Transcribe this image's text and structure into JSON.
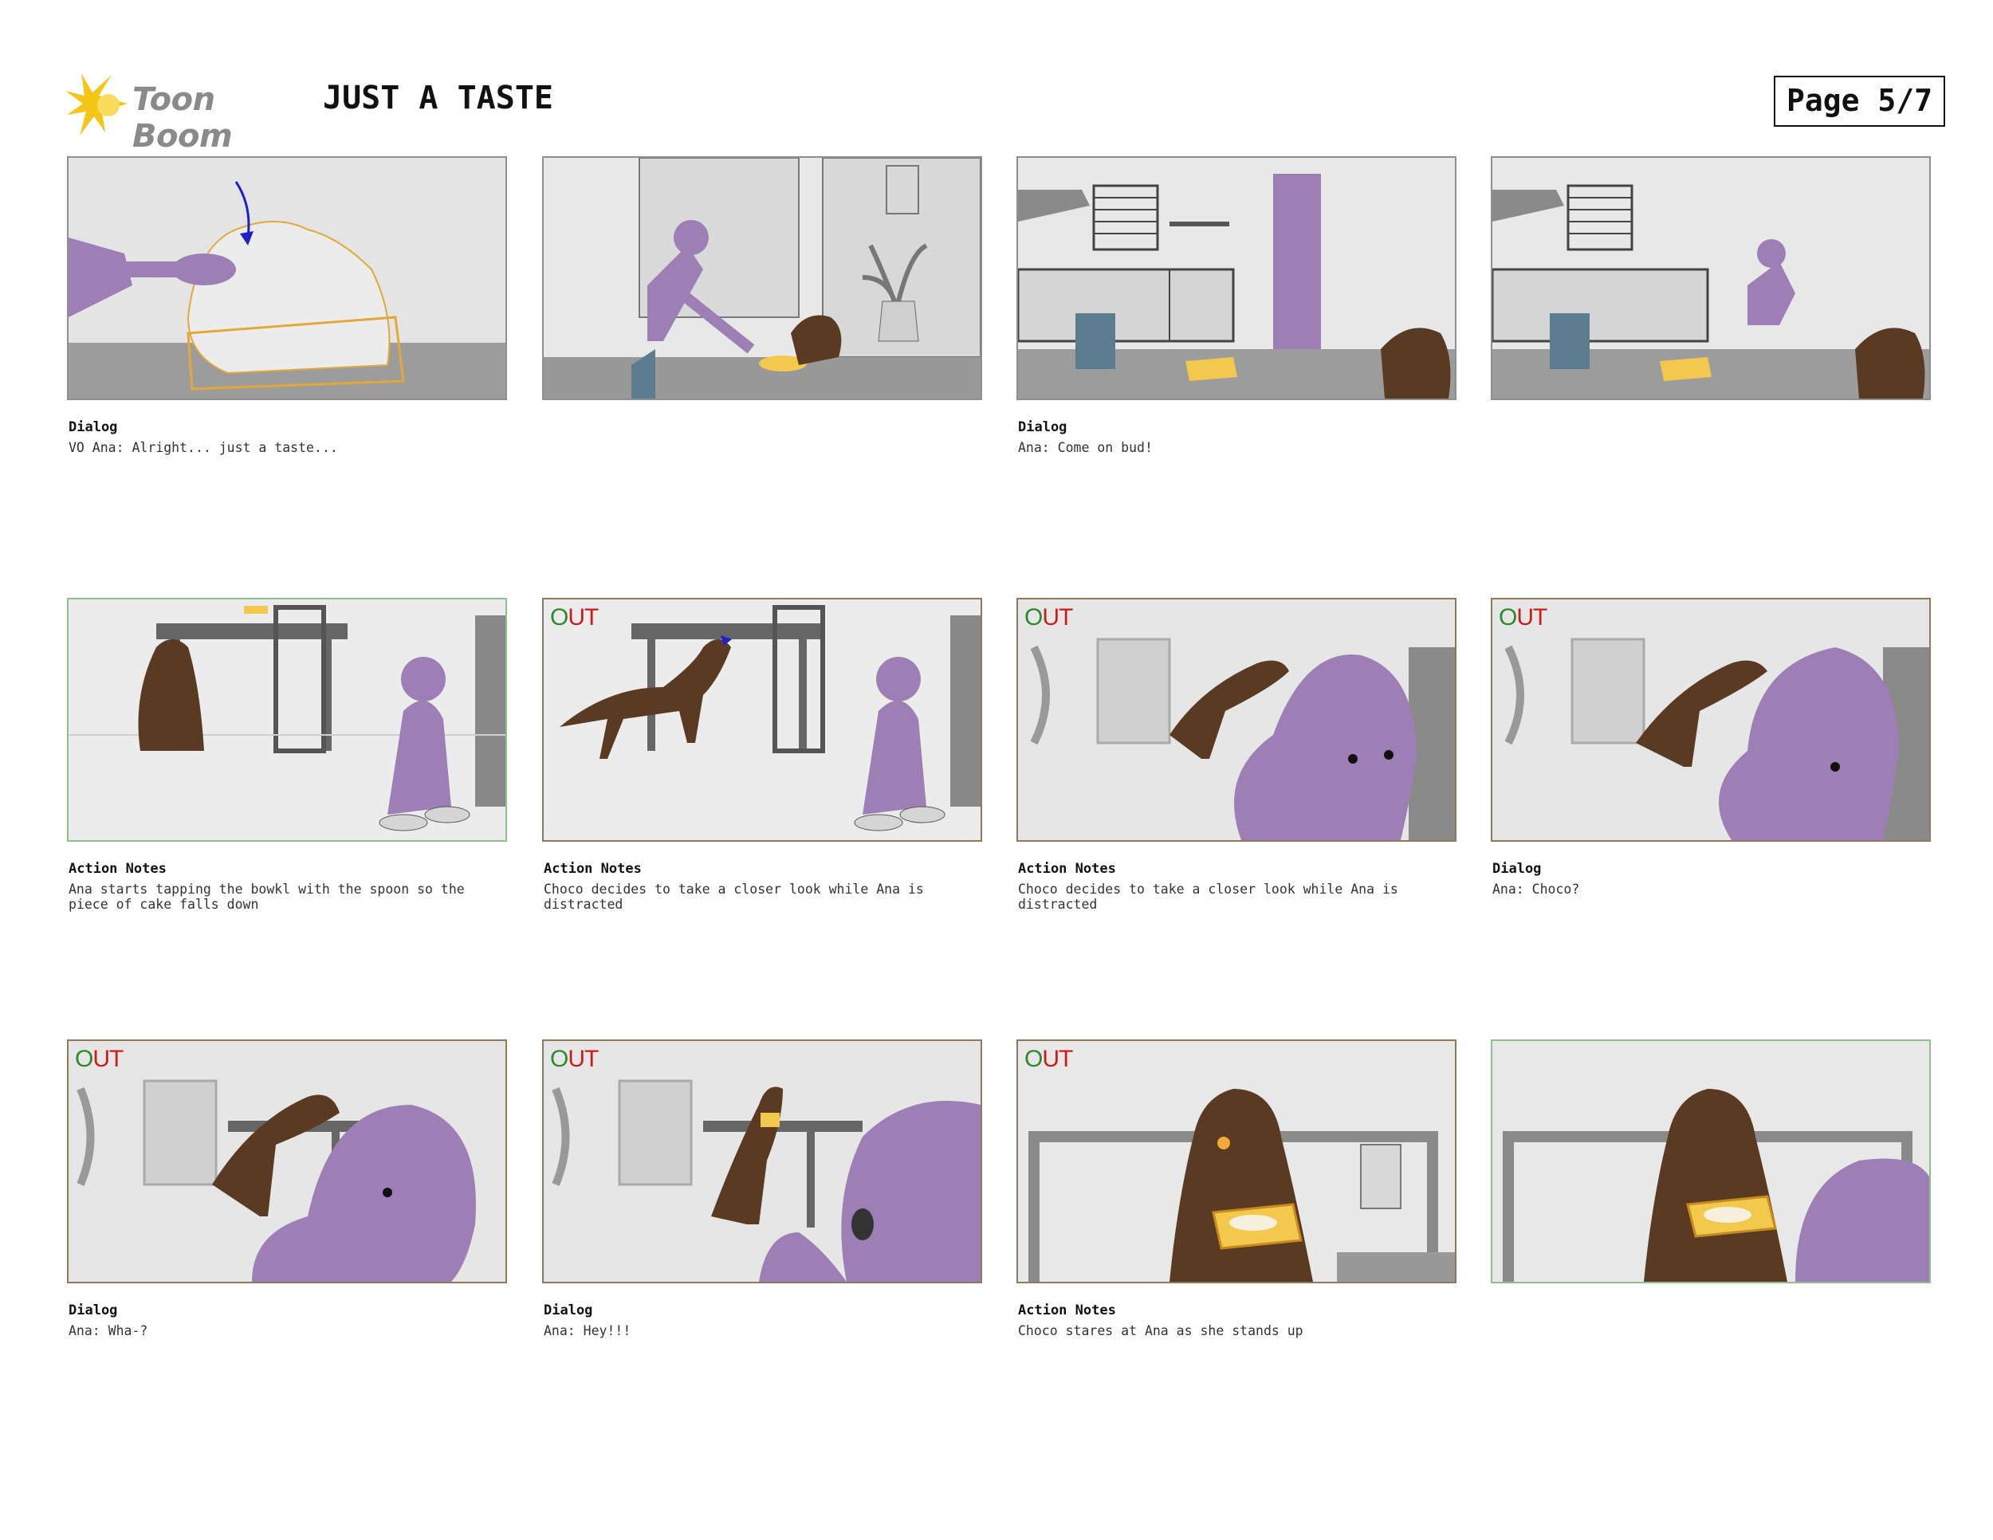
{
  "header": {
    "logo_text": "Toon Boom",
    "title": "JUST A TASTE",
    "page_label": "Page 5/7"
  },
  "panels": [
    {
      "label": "Dialog",
      "text": "VO Ana: Alright... just a taste...",
      "out": "",
      "frame_color": "#8f8f8f"
    },
    {
      "label": "",
      "text": "",
      "out": "",
      "frame_color": "#8f8f8f"
    },
    {
      "label": "Dialog",
      "text": "Ana: Come on bud!",
      "out": "",
      "frame_color": "#8f8f8f"
    },
    {
      "label": "",
      "text": "",
      "out": "",
      "frame_color": "#8f8f8f"
    },
    {
      "label": "Action Notes",
      "text": "Ana starts tapping the bowkl with the spoon so the piece of cake falls down",
      "out": "",
      "frame_color": "#8fbf8f"
    },
    {
      "label": "Action Notes",
      "text": "Choco decides to take a closer look while Ana is distracted",
      "out": "OUT",
      "frame_color": "#8e7a5a"
    },
    {
      "label": "Action Notes",
      "text": "Choco decides to take a closer look while Ana is distracted",
      "out": "OUT",
      "frame_color": "#8e7a5a"
    },
    {
      "label": "Dialog",
      "text": "Ana: Choco?",
      "out": "OUT",
      "frame_color": "#8e7a5a"
    },
    {
      "label": "Dialog",
      "text": "Ana: Wha-?",
      "out": "OUT",
      "frame_color": "#8e7a5a"
    },
    {
      "label": "Dialog",
      "text": "Ana: Hey!!!",
      "out": "OUT",
      "frame_color": "#8e7a5a"
    },
    {
      "label": "Action Notes",
      "text": "Choco stares at Ana as she stands up",
      "out": "OUT",
      "frame_color": "#8e7a5a"
    },
    {
      "label": "",
      "text": "",
      "out": "",
      "frame_color": "#8fbf8f"
    }
  ],
  "colors": {
    "ana_purple": "#9d7fb5",
    "choco_brown": "#5a3a22",
    "cake_yellow": "#f2c94c",
    "out_red": "#cc1b1b",
    "logo_yellow": "#f5c518"
  }
}
